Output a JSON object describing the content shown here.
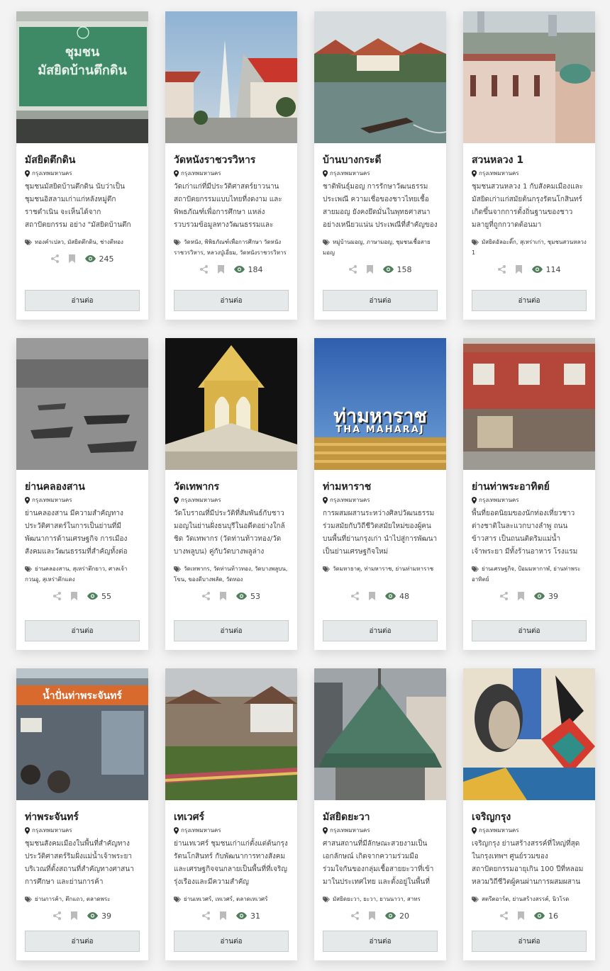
{
  "cards": [
    {
      "title": "มัสยิดตึกดิน",
      "location": "กรุงเทพมหานคร",
      "description": "ชุมชนมัสยิดบ้านตึกดิน นับว่าเป็นชุมชนอิสลามเก่าแก่หลังหมู่ตึกราชดำเนิน จะเห็นได้จากสถาปัตยกรรม อย่าง \"มัสยิดบ้านตึกดิน\"",
      "tags": "ทองคำเปลว, มัสยิดตึกดิน, ช่างตีทอง",
      "views": "245",
      "read_more": "อ่านต่อ",
      "image_sign_line1": "ชุมชน",
      "image_sign_line2": "มัสยิดบ้านตึกดิน"
    },
    {
      "title": "วัดหนังราชวรวิหาร",
      "location": "กรุงเทพมหานคร",
      "description": "วัดเก่าแก่ที่มีประวัติศาสตร์ยาวนาน สถาปัตยกรรมแบบไทยที่งดงาม และพิพธภัณฑ์เพื่อการศึกษา แหล่งรวบรวมข้อมูลทางวัฒนธรรมและประวัติศาสตร์",
      "tags": "วัดหนัง, พิพิธภัณฑ์เพื่อการศึกษา วัดหนังราชวรวิหาร, หลวงปู่เอี่ยม, วัดหนังราชวรวิหาร",
      "views": "184",
      "read_more": "อ่านต่อ"
    },
    {
      "title": "บ้านบางกระดี่",
      "location": "กรุงเทพมหานคร",
      "description": "ชาติพันธุ์มอญ การรักษาวัฒนธรรมประเพณี ความเชื่อของชาวไทยเชื้อสายมอญ ยังคงยึดมั่นในพุทธศาสนาอย่างเหนียวแน่น ประเพณีที่สำคัญของชุมชน",
      "tags": "หมู่บ้านมอญ, ภาษามอญ, ชุมชนเชื้อสายมอญ",
      "views": "158",
      "read_more": "อ่านต่อ"
    },
    {
      "title": "สวนหลวง 1",
      "location": "กรุงเทพมหานคร",
      "description": "ชุมชนสวนหลวง 1 กับสังคมเมืองและมัสยิดเก่าแก่สมัยต้นกรุงรัตนโกสินทร์ เกิดขึ้นจากการตั้งถิ่นฐานของชาวมลายูที่ถูกกวาดต้อนมา",
      "tags": "มัสยิดอัลอะติ๊ก, สุเหร่าเก่า, ชุมชนสวนหลวง 1",
      "views": "114",
      "read_more": "อ่านต่อ"
    },
    {
      "title": "ย่านคลองสาน",
      "location": "กรุงเทพมหานคร",
      "description": "ย่านคลองสาน มีความสำคัญทางประวัติศาสตร์ในการเป็นย่านที่มีพัฒนาการด้านเศรษฐกิจ การเมือง สังคมและวัฒนธรรมที่สำคัญทั้งต่อกรุงเทพฯ",
      "tags": "ย่านคลองสาน, สุเหร่าตึกยาว, ศาลเจ้ากวนอู, สุเหร่าตึกแดง",
      "views": "55",
      "read_more": "อ่านต่อ"
    },
    {
      "title": "วัดเทพากร",
      "location": "กรุงเทพมหานคร",
      "description": "วัดโบราณที่มีประวัติที่สัมพันธ์กับชาวมอญในย่านฝั่งธนบุรีในอดีตอย่างใกล้ชิด วัดเทพากร (วัดท่านท้าวทอง/วัดบางพลูบน) คู่กับวัดบางพลูล่าง",
      "tags": "วัดเทพากร, วัดท่านท้าวทอง, วัดบางพลูบน, โขน, ของดีบางพลัด, วัดทอง",
      "views": "53",
      "read_more": "อ่านต่อ"
    },
    {
      "title": "ท่ามหาราช",
      "location": "กรุงเทพมหานคร",
      "description": "การผสมผสานระหว่างศิลปวัฒนธรรมร่วมสมัยกับวิถีชีวิตสมัยใหม่ของผู้คนบนพื้นที่ย่านกรุงเก่า นำไปสู่การพัฒนาเป็นย่านเศรษฐกิจใหม่",
      "tags": "วัดมหาธาตุ, ท่ามหาราช, ย่านท่ามหาราช",
      "views": "48",
      "read_more": "อ่านต่อ",
      "image_sign_line1": "ท่ามหาราช",
      "image_sign_line2": "THA MAHARAJ"
    },
    {
      "title": "ย่านท่าพระอาทิตย์",
      "location": "กรุงเทพมหานคร",
      "description": "พื้นที่ยอดนิยมของนักท่องเที่ยวชาวต่างชาติในละแวกบางลำพู ถนนข้าวสาร เป็นถนนติดริมแม่น้ำเจ้าพระยา มีทั้งร้านอาหาร โรงแรม",
      "tags": "ย่านเศรษฐกิจ, ป้อมมหากาฬ, ย่านท่าพระอาทิตย์",
      "views": "39",
      "read_more": "อ่านต่อ"
    },
    {
      "title": "ท่าพระจันทร์",
      "location": "กรุงเทพมหานคร",
      "description": "ชุมชนสังคมเมืองในพื้นที่สำคัญทางประวัติศาสตร์ริมฝั่งแม่น้ำเจ้าพระยา บริเวณที่ตั้งสถานที่สำคัญทางศาสนา การศึกษา และย่านการค้า",
      "tags": "ย่านการค้า, ตึกแถว, ตลาดพระ",
      "views": "39",
      "read_more": "อ่านต่อ",
      "image_sign_line1": "น้ำปั่นท่าพระจันทร์"
    },
    {
      "title": "เทเวศร์",
      "location": "กรุงเทพมหานคร",
      "description": "ย่านเทเวศร์ ชุมชนเก่าแก่ตั้งแต่ต้นกรุงรัตนโกสินทร์ กับพัฒนาการทางสังคมและเศรษฐกิจจนกลายเป็นพื้นที่ที่เจริญรุ่งเรืองและมีความสำคัญ",
      "tags": "ย่านเทเวศร์, เทเวศร์, ตลาดเทเวศร์",
      "views": "31",
      "read_more": "อ่านต่อ"
    },
    {
      "title": "มัสยิดยะวา",
      "location": "กรุงเทพมหานคร",
      "description": "ศาสนสถานที่มีลักษณะสวยงามเป็นเอกลักษณ์ เกิดจากความร่วมมือร่วมใจกันของกลุ่มเชื้อสายยะวาที่เข้ามาในประเทศไทย และตั้งอยู่ในพื้นที่",
      "tags": "มัสยิดยะวา, ยะวา, ยานนาวา, สาทร",
      "views": "20",
      "read_more": "อ่านต่อ"
    },
    {
      "title": "เจริญกรุง",
      "location": "กรุงเทพมหานคร",
      "description": "เจริญกรุง ย่านสร้างสรรค์ที่ใหญ่ที่สุดในกรุงเทพฯ ศูนย์รวมของสถาปัตยกรรมอายุเกิน 100 ปีที่หลอมหลวมวิถีชีวิตผู้คนผ่านการผสมผสาน",
      "tags": "สตรีตอาร์ต, ย่านสร้างสรรค์, นิวโรด",
      "views": "16",
      "read_more": "อ่านต่อ"
    }
  ],
  "colors": {
    "accent": "#4f7f5a",
    "button_bg": "#e5e9ea",
    "icon_gray": "#b8b8b8"
  },
  "icons": [
    "map-pin-icon",
    "tag-icon",
    "share-icon",
    "bookmark-icon",
    "eye-icon"
  ]
}
